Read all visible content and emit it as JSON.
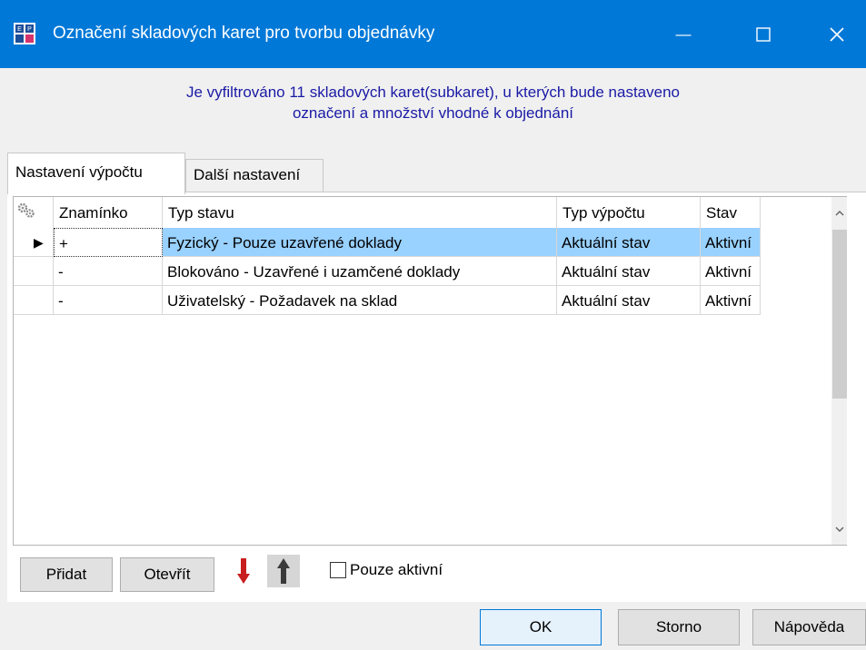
{
  "window": {
    "title": "Označení skladových karet pro tvorbu objednávky",
    "minimize_glyph": "—",
    "maximize_glyph": "☐",
    "close_glyph": "✕",
    "titlebar_color": "#0078d7"
  },
  "info": {
    "line1": "Je vyfiltrováno 11 skladových karet(subkaret), u kterých bude nastaveno",
    "line2": "označení a množství vhodné k objednání"
  },
  "tabs": [
    {
      "label": "Nastavení výpočtu",
      "active": true
    },
    {
      "label": "Další nastavení",
      "active": false
    }
  ],
  "grid": {
    "columns": [
      "Znamínko",
      "Typ stavu",
      "Typ výpočtu",
      "Stav"
    ],
    "header_icon": "gears-icon",
    "rows": [
      {
        "indicator": "▶",
        "sign": "+",
        "type": "Fyzický - Pouze uzavřené doklady",
        "calc": "Aktuální stav",
        "state": "Aktivní",
        "selected": true
      },
      {
        "indicator": "",
        "sign": "-",
        "type": "Blokováno - Uzavřené i uzamčené doklady",
        "calc": "Aktuální stav",
        "state": "Aktivní",
        "selected": false
      },
      {
        "indicator": "",
        "sign": "-",
        "type": "Uživatelský - Požadavek na sklad",
        "calc": "Aktuální stav",
        "state": "Aktivní",
        "selected": false
      }
    ],
    "selected_color": "#99d1ff"
  },
  "toolbar": {
    "add_label": "Přidat",
    "open_label": "Otevřít",
    "move_down_icon": "arrow-down-icon",
    "move_up_icon": "arrow-up-icon",
    "only_active_label": "Pouze aktivní",
    "only_active_checked": false
  },
  "footer": {
    "ok_label": "OK",
    "cancel_label": "Storno",
    "help_label": "Nápověda"
  }
}
